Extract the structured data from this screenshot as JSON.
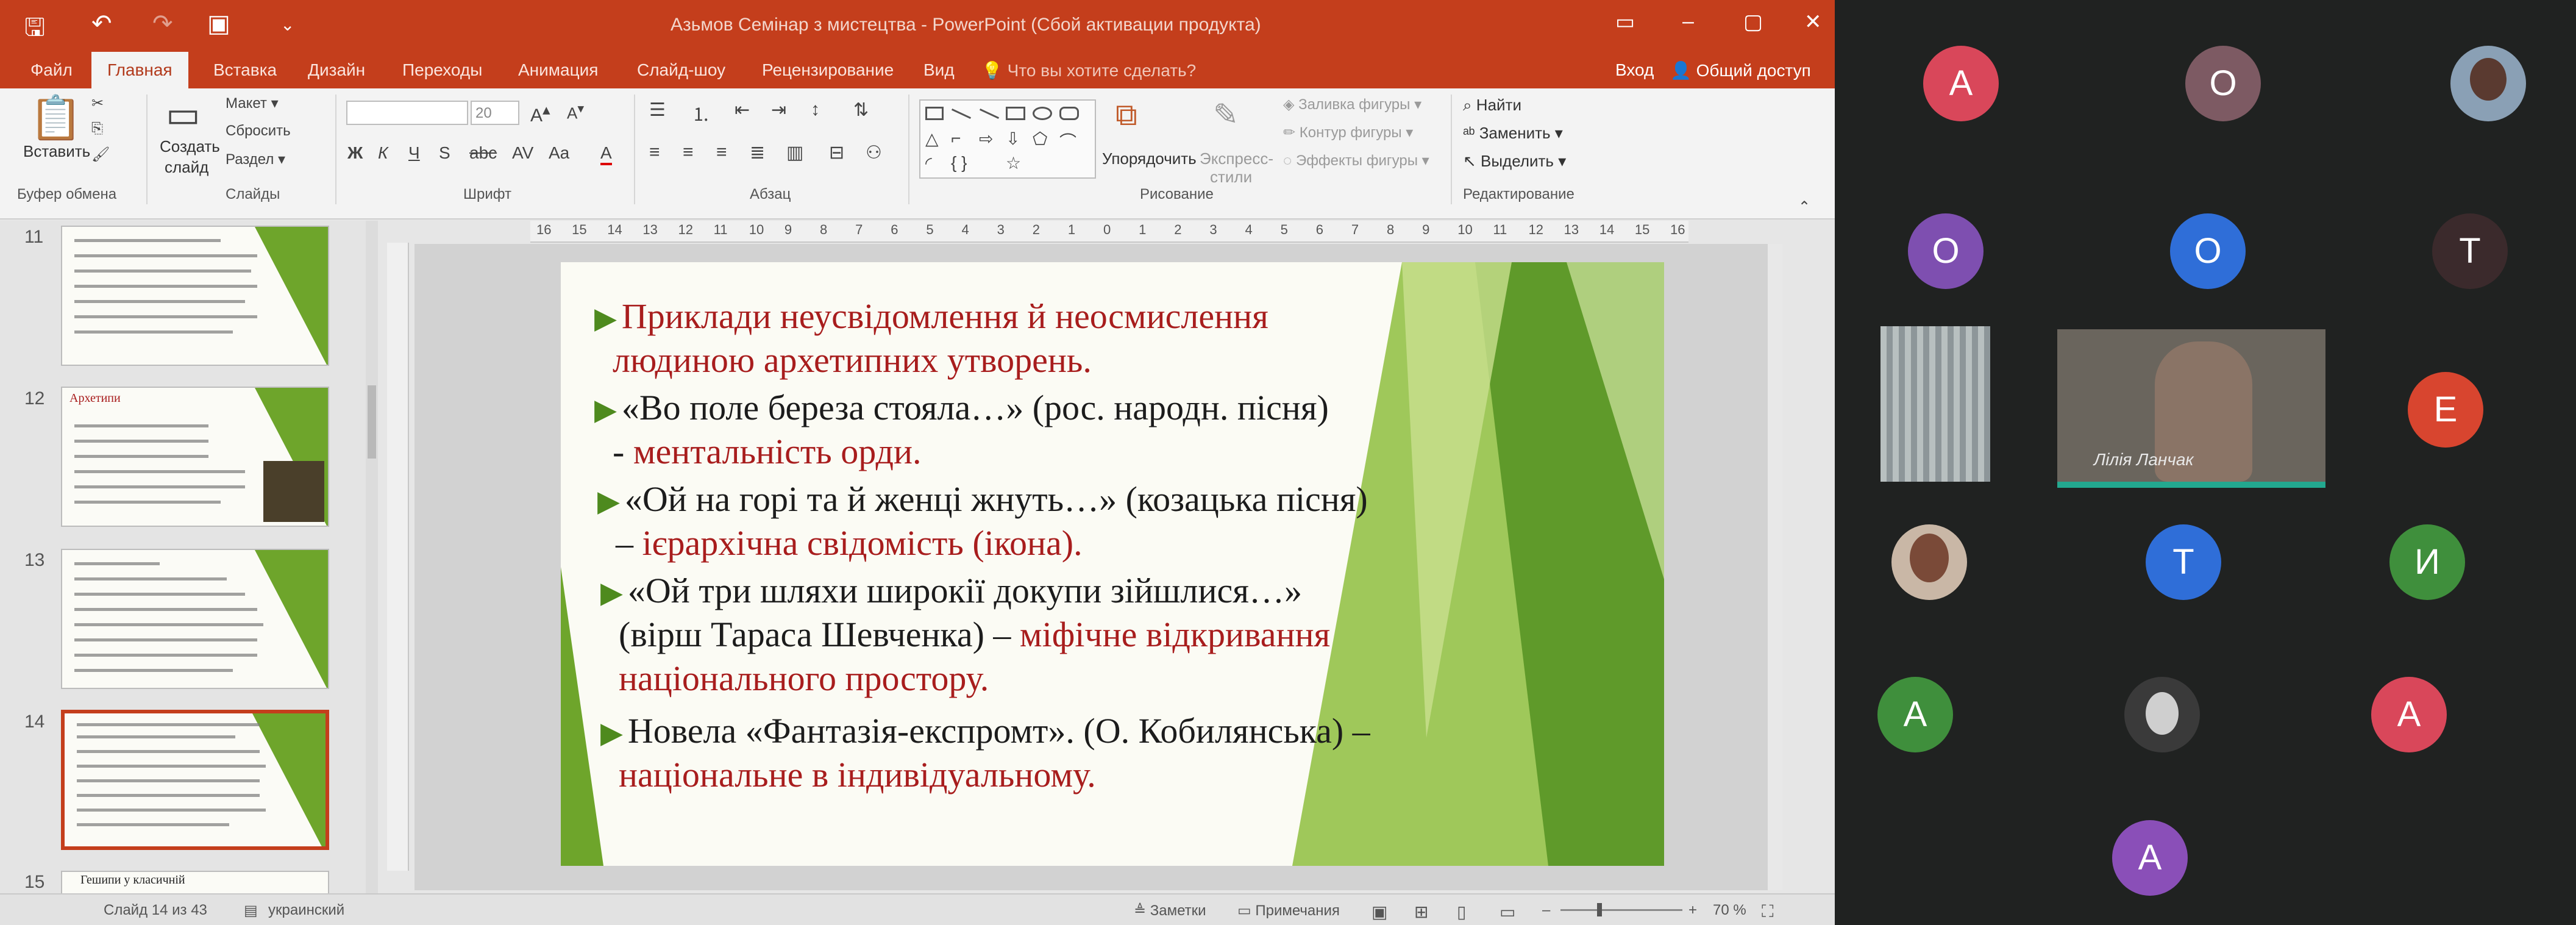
{
  "window": {
    "title": "Азьмов Семінар з мистецтва - PowerPoint (Сбой активации продукта)",
    "sign_in": "Вход",
    "share": "Общий доступ",
    "tell_me": "Что вы хотите сделать?"
  },
  "tabs": [
    "Файл",
    "Главная",
    "Вставка",
    "Дизайн",
    "Переходы",
    "Анимация",
    "Слайд-шоу",
    "Рецензирование",
    "Вид"
  ],
  "ribbon": {
    "paste": "Вставить",
    "clipboard_group": "Буфер обмена",
    "new_slide": "Создать",
    "new_slide_2": "слайд",
    "layout": "Макет",
    "reset": "Сбросить",
    "section": "Раздел",
    "slides_group": "Слайды",
    "font_size": "20",
    "font_group": "Шрифт",
    "paragraph_group": "Абзац",
    "arrange": "Упорядочить",
    "quick_styles": "Экспресс-",
    "quick_styles_2": "стили",
    "shape_fill": "Заливка фигуры",
    "shape_outline": "Контур фигуры",
    "shape_effects": "Эффекты фигуры",
    "drawing_group": "Рисование",
    "find": "Найти",
    "replace": "Заменить",
    "select": "Выделить",
    "editing_group": "Редактирование"
  },
  "ruler": {
    "h_ticks": [
      "16",
      "15",
      "14",
      "13",
      "12",
      "11",
      "10",
      "9",
      "8",
      "7",
      "6",
      "5",
      "4",
      "3",
      "2",
      "1",
      "0",
      "1",
      "2",
      "3",
      "4",
      "5",
      "6",
      "7",
      "8",
      "9",
      "10",
      "11",
      "12",
      "13",
      "14",
      "15",
      "16"
    ]
  },
  "thumbnails": [
    {
      "num": "11"
    },
    {
      "num": "12",
      "lead": "Архетипи"
    },
    {
      "num": "13"
    },
    {
      "num": "14"
    },
    {
      "num": "15",
      "lead": "Гешипи у класичній"
    }
  ],
  "slide": {
    "bullets": [
      {
        "lines": [
          [
            {
              "t": "Приклади ",
              "red": true
            },
            {
              "t": "неусвідомлення",
              "red": true
            },
            {
              "t": " й ",
              "red": true
            },
            {
              "t": "неосмислення",
              "red": true
            }
          ],
          [
            {
              "t": "людиною ",
              "red": true
            },
            {
              "t": "архетипних",
              "red": true
            },
            {
              "t": " утворень.",
              "red": true
            }
          ]
        ]
      },
      {
        "lines": [
          [
            {
              "t": "«Во поле береза стояла…» (рос. народн. пісня)",
              "red": false
            }
          ],
          [
            {
              "t": "- ",
              "red": false
            },
            {
              "t": "ментальність орди.",
              "red": true
            }
          ]
        ]
      },
      {
        "lines": [
          [
            {
              "t": "«Ой на горі та й женці жнуть…» (козацька пісня)",
              "red": false
            }
          ],
          [
            {
              "t": "– ",
              "red": false
            },
            {
              "t": "ієрархічна свідомість (ікона).",
              "red": true
            }
          ]
        ]
      },
      {
        "lines": [
          [
            {
              "t": "«Ой три шляхи широкії докупи зійшлися…»",
              "red": false
            }
          ],
          [
            {
              "t": "(вірш Тараса Шевченка) – ",
              "red": false
            },
            {
              "t": "міфічне відкривання",
              "red": true
            }
          ],
          [
            {
              "t": "національного простору.",
              "red": true
            }
          ]
        ]
      },
      {
        "lines": [
          [
            {
              "t": "Новела «Фантазія-експромт». (О. Кобилянська) –",
              "red": false
            }
          ],
          [
            {
              "t": "національне в індивідуальному.",
              "red": true
            }
          ]
        ]
      }
    ]
  },
  "status": {
    "slide_of": "Слайд 14 из 43",
    "language": "украинский",
    "notes": "Заметки",
    "comments": "Примечания",
    "zoom": "70 %"
  },
  "meeting": {
    "participants": [
      {
        "initial": "A",
        "color": "#d9475a"
      },
      {
        "initial": "O",
        "color": "#7d5a63"
      },
      {
        "initial": "O",
        "color": "#7e4fb0"
      },
      {
        "initial": "O",
        "color": "#2f6ed8"
      },
      {
        "initial": "T",
        "color": "#3b2a2c"
      },
      {
        "initial": "E",
        "color": "#d8452f"
      },
      {
        "initial": "T",
        "color": "#2f6ed8"
      },
      {
        "initial": "И",
        "color": "#3f8f3c"
      },
      {
        "initial": "A",
        "color": "#3f8f3c"
      },
      {
        "initial": "A",
        "color": "#d9475a"
      },
      {
        "initial": "A",
        "color": "#8a4fb8"
      }
    ],
    "speaker_name": "Лілія Ланчак"
  }
}
